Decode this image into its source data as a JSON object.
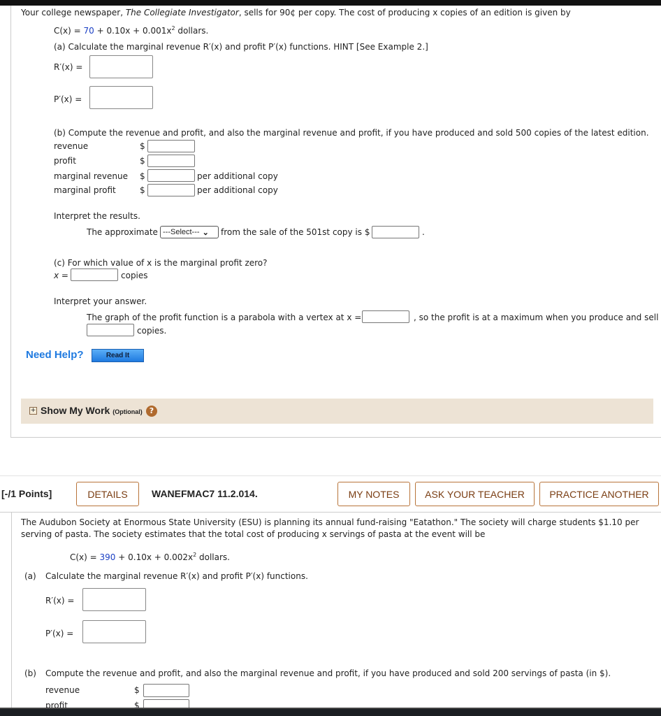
{
  "q1": {
    "intro_pre": "Your college newspaper, ",
    "intro_title": "The Collegiate Investigator",
    "intro_post": ", sells for 90¢ per copy. The cost of producing x copies of an edition is given by",
    "cost_lhs": "C(x) = ",
    "cost_const": "70",
    "cost_rest": " + 0.10x + 0.001x",
    "cost_exp": "2",
    "cost_unit": " dollars.",
    "part_a": "(a) Calculate the marginal revenue R′(x) and profit P′(x) functions. HINT [See Example 2.]",
    "r_label": "R′(x) =",
    "p_label": "P′(x) =",
    "part_b": "(b) Compute the revenue and profit, and also the marginal revenue and profit, if you have produced and sold 500 copies of the latest edition.",
    "rows": [
      {
        "label": "revenue",
        "suffix": ""
      },
      {
        "label": "profit",
        "suffix": ""
      },
      {
        "label": "marginal revenue",
        "suffix": "per additional copy"
      },
      {
        "label": "marginal profit",
        "suffix": "per additional copy"
      }
    ],
    "dollar": "$",
    "interpret": "Interpret the results.",
    "approx_pre": "The approximate",
    "select_value": "---Select---",
    "approx_post": "from the sale of the 501st copy is $",
    "period": ".",
    "part_c": "(c) For which value of x is the marginal profit zero?",
    "x_label": "x =",
    "copies": "copies",
    "interpret2": "Interpret your answer.",
    "vertex_pre": "The graph of the profit function is a parabola with a vertex at x =",
    "vertex_post": ", so the profit is at a maximum when you produce and sell",
    "copies2": "copies.",
    "need_help": "Need Help?",
    "read_it": "Read It",
    "show_work": "Show My Work",
    "optional": "(Optional)"
  },
  "q2": {
    "points": "[-/1 Points]",
    "details": "DETAILS",
    "code": "WANEFMAC7 11.2.014.",
    "my_notes": "MY NOTES",
    "ask_teacher": "ASK YOUR TEACHER",
    "practice": "PRACTICE ANOTHER",
    "intro1": "The Audubon Society at Enormous State University (ESU) is planning its annual fund-raising \"Eatathon.\" The society will charge students $1.10 per",
    "intro2": "serving of pasta. The society estimates that the total cost of producing x servings of pasta at the event will be",
    "cost_lhs": "C(x) = ",
    "cost_const": "390",
    "cost_rest": " + 0.10x + 0.002x",
    "cost_exp": "2",
    "cost_unit": " dollars.",
    "part_a_tag": "(a)",
    "part_a": "Calculate the marginal revenue R′(x) and profit P′(x) functions.",
    "r_label": "R′(x) =",
    "p_label": "P′(x) =",
    "part_b_tag": "(b)",
    "part_b": "Compute the revenue and profit, and also the marginal revenue and profit, if you have produced and sold 200 servings of pasta (in $).",
    "rows": [
      {
        "label": "revenue"
      },
      {
        "label": "profit"
      }
    ],
    "dollar": "$"
  },
  "colors": {
    "accent_button_border": "#b8743a",
    "link_blue": "#1f7ae0",
    "show_work_bg": "#ede3d5"
  }
}
